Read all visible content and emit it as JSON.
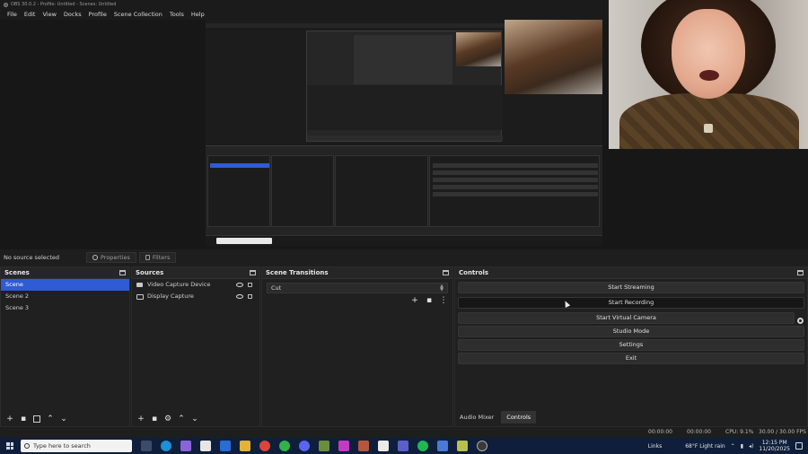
{
  "window": {
    "title": "OBS 30.0.2 - Profile: Untitled - Scenes: Untitled"
  },
  "menu": [
    "File",
    "Edit",
    "View",
    "Docks",
    "Profile",
    "Scene Collection",
    "Tools",
    "Help"
  ],
  "source_toolbar": {
    "no_source": "No source selected",
    "properties": "Properties",
    "filters": "Filters"
  },
  "scenes": {
    "title": "Scenes",
    "items": [
      "Scene",
      "Scene 2",
      "Scene 3"
    ],
    "selected_index": 0
  },
  "sources": {
    "title": "Sources",
    "items": [
      {
        "label": "Video Capture Device",
        "icon": "camera-icon"
      },
      {
        "label": "Display Capture",
        "icon": "monitor-icon"
      }
    ]
  },
  "transitions": {
    "title": "Scene Transitions",
    "selected": "Cut"
  },
  "controls": {
    "title": "Controls",
    "buttons": [
      "Start Streaming",
      "Start Recording",
      "Start Virtual Camera",
      "Studio Mode",
      "Settings",
      "Exit"
    ]
  },
  "control_tabs": [
    "Audio Mixer",
    "Controls"
  ],
  "status": {
    "rec_time_1": "00:00:00",
    "rec_time_2": "00:00:00",
    "cpu": "CPU: 9.1%",
    "fps": "30.00 / 30.00 FPS"
  },
  "taskbar": {
    "search_placeholder": "Type here to search",
    "links": "Links",
    "weather": "68°F  Light rain",
    "time": "12:15 PM",
    "date": "11/20/2025"
  },
  "colors": {
    "selection": "#2f5bd3",
    "panel": "#202020",
    "taskbar": "#0f1f3b"
  }
}
